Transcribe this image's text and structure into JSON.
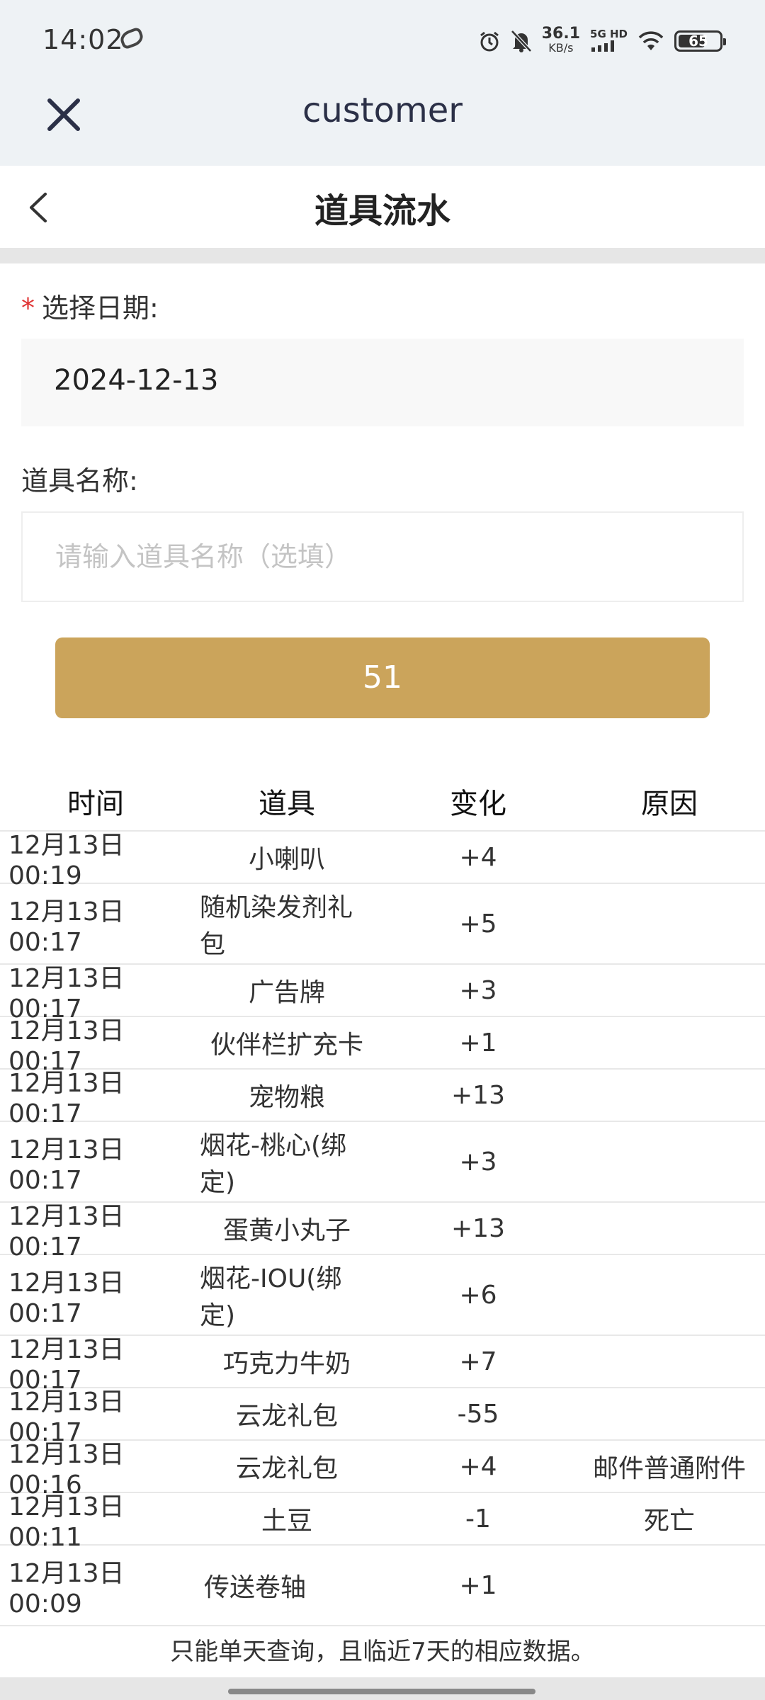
{
  "status_bar": {
    "time": "14:02",
    "speed_value": "36.1",
    "speed_unit": "KB/s",
    "network": "5G HD",
    "battery_level": "65",
    "icons": [
      "alarm-icon",
      "mute-icon",
      "signal-icon",
      "wifi-icon",
      "battery-icon"
    ]
  },
  "webview": {
    "title": "customer"
  },
  "header": {
    "title": "道具流水"
  },
  "form": {
    "date_required_mark": "*",
    "date_label": "选择日期:",
    "date_value": "2024-12-13",
    "name_label": "道具名称:",
    "name_placeholder": "请输入道具名称（选填）",
    "submit_label": "51"
  },
  "table": {
    "columns": [
      "时间",
      "道具",
      "变化",
      "原因"
    ],
    "rows": [
      {
        "time": "12月13日 00:19",
        "item": "小喇叭",
        "change": "+4",
        "reason": ""
      },
      {
        "time": "12月13日 00:17",
        "item": "随机染发剂礼包",
        "change": "+5",
        "reason": ""
      },
      {
        "time": "12月13日 00:17",
        "item": "广告牌",
        "change": "+3",
        "reason": ""
      },
      {
        "time": "12月13日 00:17",
        "item": "伙伴栏扩充卡",
        "change": "+1",
        "reason": ""
      },
      {
        "time": "12月13日 00:17",
        "item": "宠物粮",
        "change": "+13",
        "reason": ""
      },
      {
        "time": "12月13日 00:17",
        "item": "烟花-桃心(绑定)",
        "change": "+3",
        "reason": ""
      },
      {
        "time": "12月13日 00:17",
        "item": "蛋黄小丸子",
        "change": "+13",
        "reason": ""
      },
      {
        "time": "12月13日 00:17",
        "item": "烟花-IOU(绑定)",
        "change": "+6",
        "reason": ""
      },
      {
        "time": "12月13日 00:17",
        "item": "巧克力牛奶",
        "change": "+7",
        "reason": ""
      },
      {
        "time": "12月13日 00:17",
        "item": "云龙礼包",
        "change": "-55",
        "reason": ""
      },
      {
        "time": "12月13日 00:16",
        "item": "云龙礼包",
        "change": "+4",
        "reason": "邮件普通附件"
      },
      {
        "time": "12月13日 00:11",
        "item": "土豆",
        "change": "-1",
        "reason": "死亡"
      },
      {
        "time": "12月13日 00:09",
        "item": "传送卷轴",
        "change": "+1",
        "reason": ""
      }
    ]
  },
  "footer": {
    "note": "只能单天查询，且临近7天的相应数据。"
  }
}
